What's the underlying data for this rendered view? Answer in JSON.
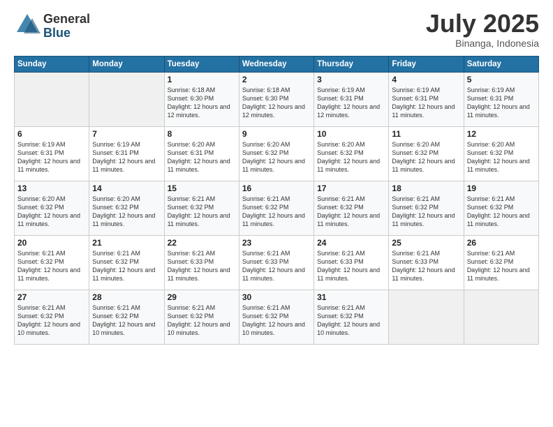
{
  "logo": {
    "general": "General",
    "blue": "Blue"
  },
  "header": {
    "month_year": "July 2025",
    "location": "Binanga, Indonesia"
  },
  "weekdays": [
    "Sunday",
    "Monday",
    "Tuesday",
    "Wednesday",
    "Thursday",
    "Friday",
    "Saturday"
  ],
  "weeks": [
    [
      {
        "day": "",
        "sunrise": "",
        "sunset": "",
        "daylight": ""
      },
      {
        "day": "",
        "sunrise": "",
        "sunset": "",
        "daylight": ""
      },
      {
        "day": "1",
        "sunrise": "Sunrise: 6:18 AM",
        "sunset": "Sunset: 6:30 PM",
        "daylight": "Daylight: 12 hours and 12 minutes."
      },
      {
        "day": "2",
        "sunrise": "Sunrise: 6:18 AM",
        "sunset": "Sunset: 6:30 PM",
        "daylight": "Daylight: 12 hours and 12 minutes."
      },
      {
        "day": "3",
        "sunrise": "Sunrise: 6:19 AM",
        "sunset": "Sunset: 6:31 PM",
        "daylight": "Daylight: 12 hours and 12 minutes."
      },
      {
        "day": "4",
        "sunrise": "Sunrise: 6:19 AM",
        "sunset": "Sunset: 6:31 PM",
        "daylight": "Daylight: 12 hours and 11 minutes."
      },
      {
        "day": "5",
        "sunrise": "Sunrise: 6:19 AM",
        "sunset": "Sunset: 6:31 PM",
        "daylight": "Daylight: 12 hours and 11 minutes."
      }
    ],
    [
      {
        "day": "6",
        "sunrise": "Sunrise: 6:19 AM",
        "sunset": "Sunset: 6:31 PM",
        "daylight": "Daylight: 12 hours and 11 minutes."
      },
      {
        "day": "7",
        "sunrise": "Sunrise: 6:19 AM",
        "sunset": "Sunset: 6:31 PM",
        "daylight": "Daylight: 12 hours and 11 minutes."
      },
      {
        "day": "8",
        "sunrise": "Sunrise: 6:20 AM",
        "sunset": "Sunset: 6:31 PM",
        "daylight": "Daylight: 12 hours and 11 minutes."
      },
      {
        "day": "9",
        "sunrise": "Sunrise: 6:20 AM",
        "sunset": "Sunset: 6:32 PM",
        "daylight": "Daylight: 12 hours and 11 minutes."
      },
      {
        "day": "10",
        "sunrise": "Sunrise: 6:20 AM",
        "sunset": "Sunset: 6:32 PM",
        "daylight": "Daylight: 12 hours and 11 minutes."
      },
      {
        "day": "11",
        "sunrise": "Sunrise: 6:20 AM",
        "sunset": "Sunset: 6:32 PM",
        "daylight": "Daylight: 12 hours and 11 minutes."
      },
      {
        "day": "12",
        "sunrise": "Sunrise: 6:20 AM",
        "sunset": "Sunset: 6:32 PM",
        "daylight": "Daylight: 12 hours and 11 minutes."
      }
    ],
    [
      {
        "day": "13",
        "sunrise": "Sunrise: 6:20 AM",
        "sunset": "Sunset: 6:32 PM",
        "daylight": "Daylight: 12 hours and 11 minutes."
      },
      {
        "day": "14",
        "sunrise": "Sunrise: 6:20 AM",
        "sunset": "Sunset: 6:32 PM",
        "daylight": "Daylight: 12 hours and 11 minutes."
      },
      {
        "day": "15",
        "sunrise": "Sunrise: 6:21 AM",
        "sunset": "Sunset: 6:32 PM",
        "daylight": "Daylight: 12 hours and 11 minutes."
      },
      {
        "day": "16",
        "sunrise": "Sunrise: 6:21 AM",
        "sunset": "Sunset: 6:32 PM",
        "daylight": "Daylight: 12 hours and 11 minutes."
      },
      {
        "day": "17",
        "sunrise": "Sunrise: 6:21 AM",
        "sunset": "Sunset: 6:32 PM",
        "daylight": "Daylight: 12 hours and 11 minutes."
      },
      {
        "day": "18",
        "sunrise": "Sunrise: 6:21 AM",
        "sunset": "Sunset: 6:32 PM",
        "daylight": "Daylight: 12 hours and 11 minutes."
      },
      {
        "day": "19",
        "sunrise": "Sunrise: 6:21 AM",
        "sunset": "Sunset: 6:32 PM",
        "daylight": "Daylight: 12 hours and 11 minutes."
      }
    ],
    [
      {
        "day": "20",
        "sunrise": "Sunrise: 6:21 AM",
        "sunset": "Sunset: 6:32 PM",
        "daylight": "Daylight: 12 hours and 11 minutes."
      },
      {
        "day": "21",
        "sunrise": "Sunrise: 6:21 AM",
        "sunset": "Sunset: 6:32 PM",
        "daylight": "Daylight: 12 hours and 11 minutes."
      },
      {
        "day": "22",
        "sunrise": "Sunrise: 6:21 AM",
        "sunset": "Sunset: 6:33 PM",
        "daylight": "Daylight: 12 hours and 11 minutes."
      },
      {
        "day": "23",
        "sunrise": "Sunrise: 6:21 AM",
        "sunset": "Sunset: 6:33 PM",
        "daylight": "Daylight: 12 hours and 11 minutes."
      },
      {
        "day": "24",
        "sunrise": "Sunrise: 6:21 AM",
        "sunset": "Sunset: 6:33 PM",
        "daylight": "Daylight: 12 hours and 11 minutes."
      },
      {
        "day": "25",
        "sunrise": "Sunrise: 6:21 AM",
        "sunset": "Sunset: 6:33 PM",
        "daylight": "Daylight: 12 hours and 11 minutes."
      },
      {
        "day": "26",
        "sunrise": "Sunrise: 6:21 AM",
        "sunset": "Sunset: 6:32 PM",
        "daylight": "Daylight: 12 hours and 11 minutes."
      }
    ],
    [
      {
        "day": "27",
        "sunrise": "Sunrise: 6:21 AM",
        "sunset": "Sunset: 6:32 PM",
        "daylight": "Daylight: 12 hours and 10 minutes."
      },
      {
        "day": "28",
        "sunrise": "Sunrise: 6:21 AM",
        "sunset": "Sunset: 6:32 PM",
        "daylight": "Daylight: 12 hours and 10 minutes."
      },
      {
        "day": "29",
        "sunrise": "Sunrise: 6:21 AM",
        "sunset": "Sunset: 6:32 PM",
        "daylight": "Daylight: 12 hours and 10 minutes."
      },
      {
        "day": "30",
        "sunrise": "Sunrise: 6:21 AM",
        "sunset": "Sunset: 6:32 PM",
        "daylight": "Daylight: 12 hours and 10 minutes."
      },
      {
        "day": "31",
        "sunrise": "Sunrise: 6:21 AM",
        "sunset": "Sunset: 6:32 PM",
        "daylight": "Daylight: 12 hours and 10 minutes."
      },
      {
        "day": "",
        "sunrise": "",
        "sunset": "",
        "daylight": ""
      },
      {
        "day": "",
        "sunrise": "",
        "sunset": "",
        "daylight": ""
      }
    ]
  ]
}
